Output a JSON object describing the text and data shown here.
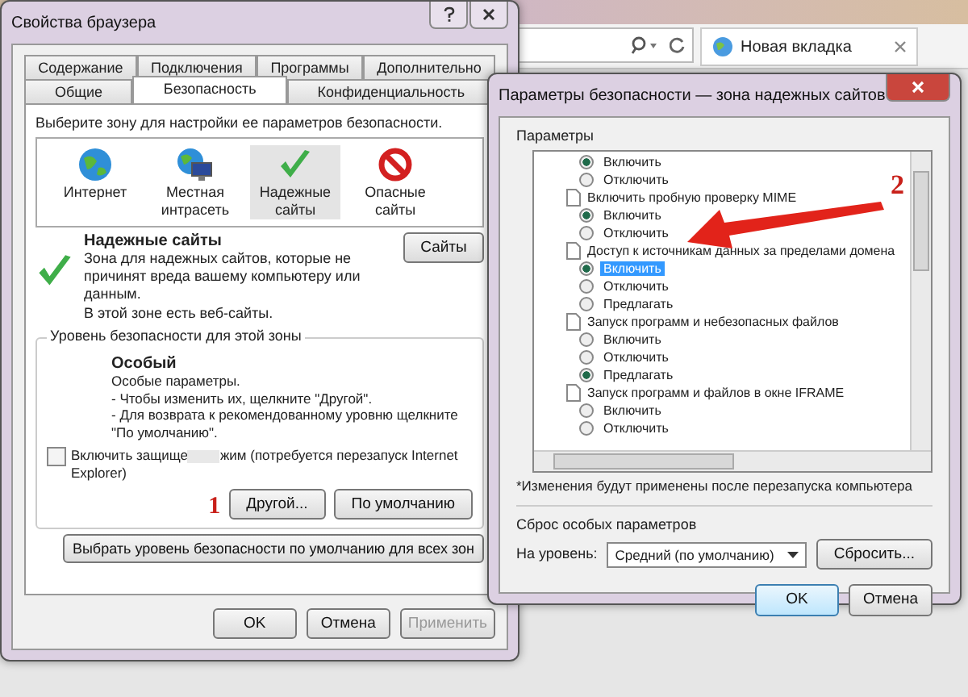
{
  "browser": {
    "tab_title": "Новая вкладка"
  },
  "internet_options": {
    "title": "Свойства браузера",
    "tab_rows": [
      [
        {
          "label": "Содержание",
          "selected": false
        },
        {
          "label": "Подключения",
          "selected": false
        },
        {
          "label": "Программы",
          "selected": false
        },
        {
          "label": "Дополнительно",
          "selected": false
        }
      ],
      [
        {
          "label": "Общие",
          "selected": false
        },
        {
          "label": "Безопасность",
          "selected": true
        },
        {
          "label": "Конфиденциальность",
          "selected": false
        }
      ]
    ],
    "zone_prompt": "Выберите зону для настройки ее параметров безопасности.",
    "zones": [
      {
        "kind": "internet",
        "label": "Интернет",
        "selected": false
      },
      {
        "kind": "intranet",
        "label": "Местная интрасеть",
        "selected": false
      },
      {
        "kind": "trusted",
        "label": "Надежные сайты",
        "selected": true
      },
      {
        "kind": "restricted",
        "label": "Опасные сайты",
        "selected": false
      }
    ],
    "zone_title": "Надежные сайты",
    "zone_description": "Зона для надежных сайтов, которые не причинят вреда вашему компьютеру или данным.",
    "zone_note": "В этой зоне есть веб-сайты.",
    "sites_button": "Сайты",
    "level_group": {
      "legend": "Уровень безопасности для этой зоны",
      "level_name": "Особый",
      "lines": [
        "Особые параметры.",
        "- Чтобы изменить их, щелкните \"Другой\".",
        "- Для возврата к рекомендованному уровню щелкните \"По умолчанию\"."
      ],
      "protected_mode": {
        "checked": false,
        "text_before": "Включить защище",
        "text_after": "жим (потребуется перезапуск Internet Explorer)"
      },
      "annotation": "1",
      "buttons": [
        "Другой...",
        "По умолчанию"
      ]
    },
    "reset_all_button": "Выбрать уровень безопасности по умолчанию для всех зон",
    "footer_buttons": [
      {
        "label": "OK",
        "disabled": false
      },
      {
        "label": "Отмена",
        "disabled": false
      },
      {
        "label": "Применить",
        "disabled": true
      }
    ]
  },
  "security_settings": {
    "title": "Параметры безопасности — зона надежных сайтов",
    "settings_label": "Параметры",
    "groups": [
      {
        "options": [
          {
            "label": "Включить",
            "selected": true,
            "highlighted": false
          },
          {
            "label": "Отключить",
            "selected": false,
            "highlighted": false
          }
        ]
      },
      {
        "title": "Включить пробную проверку MIME",
        "options": [
          {
            "label": "Включить",
            "selected": true,
            "highlighted": false
          },
          {
            "label": "Отключить",
            "selected": false,
            "highlighted": false
          }
        ]
      },
      {
        "title": "Доступ к источникам данных за пределами домена",
        "options": [
          {
            "label": "Включить",
            "selected": true,
            "highlighted": true
          },
          {
            "label": "Отключить",
            "selected": false,
            "highlighted": false
          },
          {
            "label": "Предлагать",
            "selected": false,
            "highlighted": false
          }
        ]
      },
      {
        "title": "Запуск программ и небезопасных файлов",
        "options": [
          {
            "label": "Включить",
            "selected": false,
            "highlighted": false
          },
          {
            "label": "Отключить",
            "selected": false,
            "highlighted": false
          },
          {
            "label": "Предлагать",
            "selected": true,
            "highlighted": false
          }
        ]
      },
      {
        "title": "Запуск программ и файлов в окне IFRAME",
        "options": [
          {
            "label": "Включить",
            "selected": false,
            "highlighted": false
          },
          {
            "label": "Отключить",
            "selected": false,
            "highlighted": false
          }
        ]
      }
    ],
    "note": "*Изменения будут применены после перезапуска компьютера",
    "reset_label": "Сброс особых параметров",
    "level_label": "На уровень:",
    "level_value": "Средний (по умолчанию)",
    "reset_button": "Сбросить...",
    "annotation": "2",
    "footer_buttons": [
      "OK",
      "Отмена"
    ]
  }
}
